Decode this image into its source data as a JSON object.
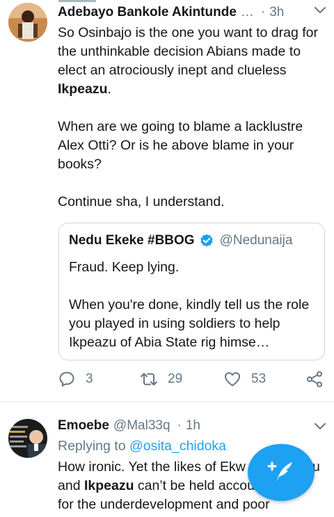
{
  "tweets": [
    {
      "author": "Adebayo Bankole Akintunde",
      "handle": "…",
      "time": "3h",
      "paragraphs": [
        [
          "So Osinbajo is the one you want to drag for the unthinkable decision Abians made to elect an atrociously inept and clueless ",
          "Ikpeazu",
          "."
        ],
        [
          "When are we going to blame a lacklustre Alex Otti? Or is he above blame in your books?"
        ],
        [
          "Continue sha, I understand."
        ]
      ],
      "quote": {
        "author": "Nedu Ekeke #BBOG",
        "handle": "@Nedunaija",
        "paragraphs": [
          "Fraud. Keep lying.",
          "When you're done, kindly tell us the role you played in using soldiers to help Ikpeazu of Abia State rig himse…"
        ]
      },
      "actions": {
        "replies": "3",
        "retweets": "29",
        "likes": "53"
      }
    },
    {
      "author": "Emoebe",
      "handle": "@Mal33q",
      "time": "1h",
      "replying_label": "Replying to",
      "replying_to": "@osita_chidoka",
      "lines": [
        [
          "How ironic. Yet the likes of Ekw",
          "",
          "u"
        ],
        [
          "and ",
          "Ikpeazu",
          " can’t be held accou"
        ],
        [
          "for the underdevelopment and poor",
          "",
          ""
        ]
      ]
    }
  ],
  "colors": {
    "accent": "#1da1f2",
    "secondary_text": "#657786",
    "border": "#ccd6dd"
  },
  "icons": [
    "chevron-down-icon",
    "verified-badge-icon",
    "reply-icon",
    "retweet-icon",
    "like-icon",
    "share-icon",
    "compose-tweet-icon"
  ]
}
